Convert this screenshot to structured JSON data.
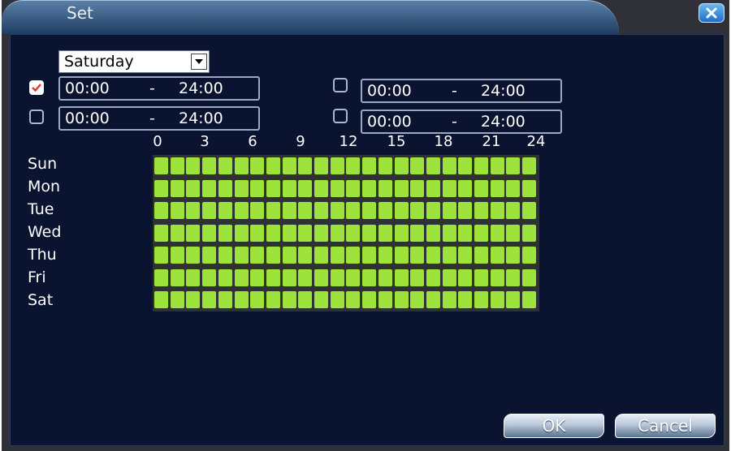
{
  "window": {
    "title": "Set"
  },
  "day_select": {
    "value": "Saturday"
  },
  "periods": [
    {
      "enabled": true,
      "start": "00:00",
      "end": "24:00"
    },
    {
      "enabled": false,
      "start": "00:00",
      "end": "24:00"
    },
    {
      "enabled": false,
      "start": "00:00",
      "end": "24:00"
    },
    {
      "enabled": false,
      "start": "00:00",
      "end": "24:00"
    }
  ],
  "time_separator": "-",
  "hour_ticks": [
    "0",
    "3",
    "6",
    "9",
    "12",
    "15",
    "18",
    "21",
    "24"
  ],
  "days": [
    "Sun",
    "Mon",
    "Tue",
    "Wed",
    "Thu",
    "Fri",
    "Sat"
  ],
  "schedule": {
    "slots_per_day": 24,
    "all_selected": true,
    "selected_color": "#9ee23c"
  },
  "buttons": {
    "ok": "OK",
    "cancel": "Cancel"
  },
  "icons": {
    "close": "close-icon",
    "dropdown": "chevron-down-icon",
    "check": "check-icon"
  }
}
